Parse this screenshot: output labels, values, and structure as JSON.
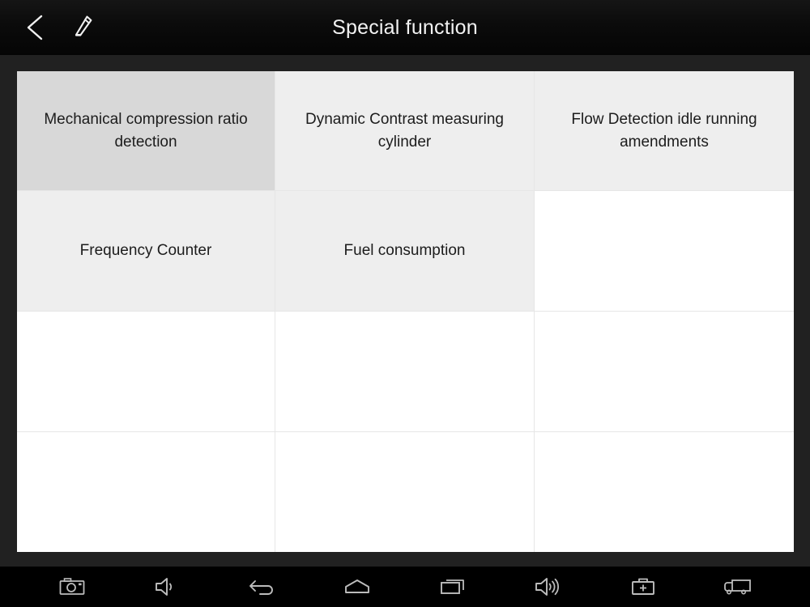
{
  "titlebar": {
    "title": "Special function",
    "back_icon": "chevron-left-icon",
    "edit_icon": "pencil-icon"
  },
  "grid": {
    "columns": 3,
    "rows": 4,
    "cells": [
      {
        "label": "Mechanical compression ratio detection",
        "state": "selected"
      },
      {
        "label": "Dynamic Contrast measuring cylinder",
        "state": "filled"
      },
      {
        "label": "Flow Detection idle running amendments",
        "state": "filled"
      },
      {
        "label": "Frequency Counter",
        "state": "filled"
      },
      {
        "label": "Fuel consumption",
        "state": "filled"
      },
      {
        "label": "",
        "state": "empty"
      },
      {
        "label": "",
        "state": "empty"
      },
      {
        "label": "",
        "state": "empty"
      },
      {
        "label": "",
        "state": "empty"
      },
      {
        "label": "",
        "state": "empty"
      },
      {
        "label": "",
        "state": "empty"
      },
      {
        "label": "",
        "state": "empty"
      }
    ]
  },
  "navbar": {
    "buttons": [
      {
        "icon": "camera-icon",
        "label": "Screenshot"
      },
      {
        "icon": "volume-down-icon",
        "label": "Volume down"
      },
      {
        "icon": "back-arrow-icon",
        "label": "Back"
      },
      {
        "icon": "home-icon",
        "label": "Home"
      },
      {
        "icon": "recent-apps-icon",
        "label": "Recent apps"
      },
      {
        "icon": "volume-up-icon",
        "label": "Volume up"
      },
      {
        "icon": "toolbox-icon",
        "label": "Toolbox"
      },
      {
        "icon": "truck-icon",
        "label": "Vehicle"
      }
    ]
  },
  "colors": {
    "titlebar_bg": "#0b0b0b",
    "page_bg": "#212121",
    "grid_bg": "#ffffff",
    "cell_filled": "#eeeeee",
    "cell_selected": "#d8d8d8",
    "cell_border": "#e6e6e6",
    "title_text": "#f2f2f2",
    "cell_text": "#1c1c1c",
    "navbar_bg": "#000000",
    "nav_icon": "#bcbcbc"
  }
}
